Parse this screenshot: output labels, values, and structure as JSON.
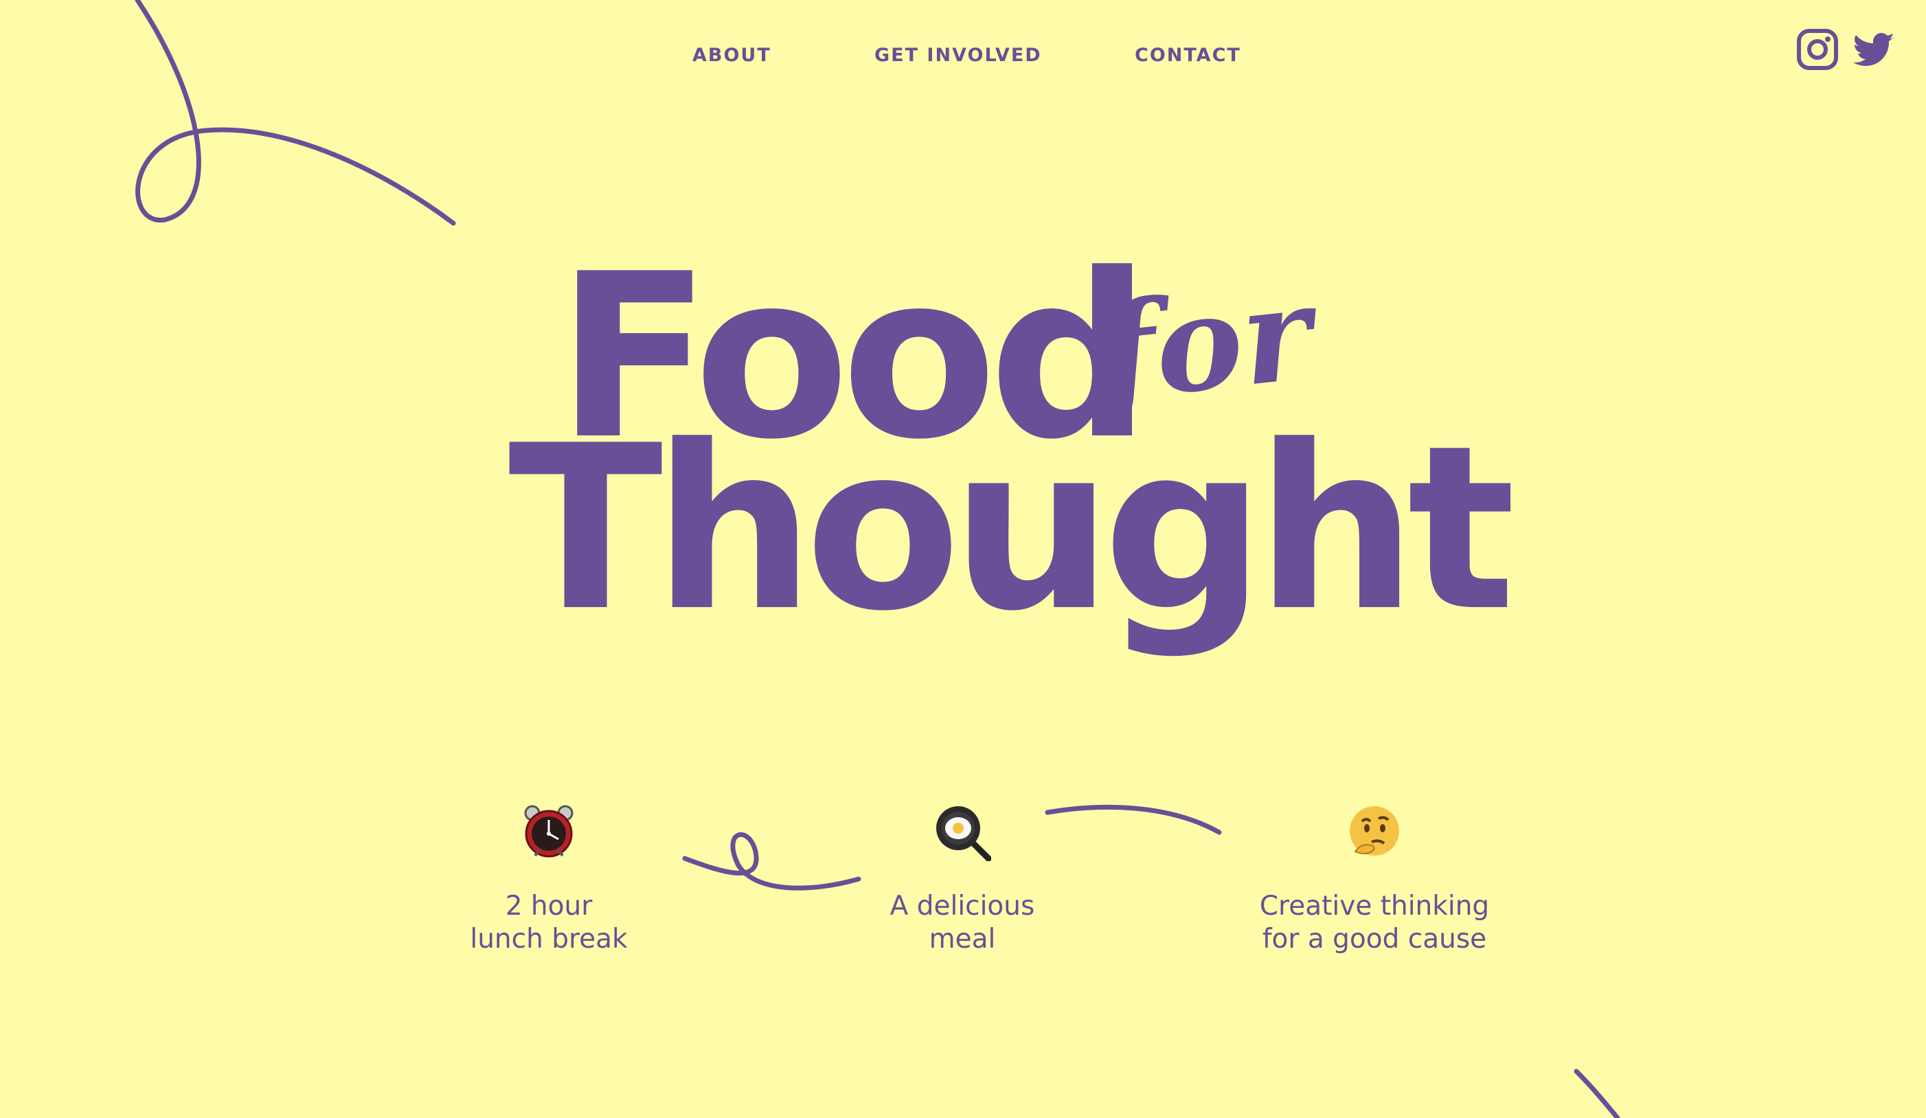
{
  "colors": {
    "background": "#fefca8",
    "accent": "#684f98",
    "clock_red": "#b4232a",
    "egg_yolk": "#f4c33b",
    "thinker_yellow": "#f6c243"
  },
  "nav": {
    "items": [
      {
        "label": "ABOUT"
      },
      {
        "label": "GET INVOLVED"
      },
      {
        "label": "CONTACT"
      }
    ]
  },
  "social": {
    "instagram_icon": "instagram-icon",
    "twitter_icon": "twitter-icon"
  },
  "hero": {
    "logo_word_1": "Food",
    "logo_word_2": "for",
    "logo_word_3": "Thought"
  },
  "features": [
    {
      "icon": "alarm-clock-icon",
      "line1": "2 hour",
      "line2": "lunch break"
    },
    {
      "icon": "frying-pan-egg-icon",
      "line1": "A delicious",
      "line2": "meal"
    },
    {
      "icon": "thinking-face-icon",
      "line1": "Creative thinking",
      "line2": "for a good cause"
    }
  ]
}
